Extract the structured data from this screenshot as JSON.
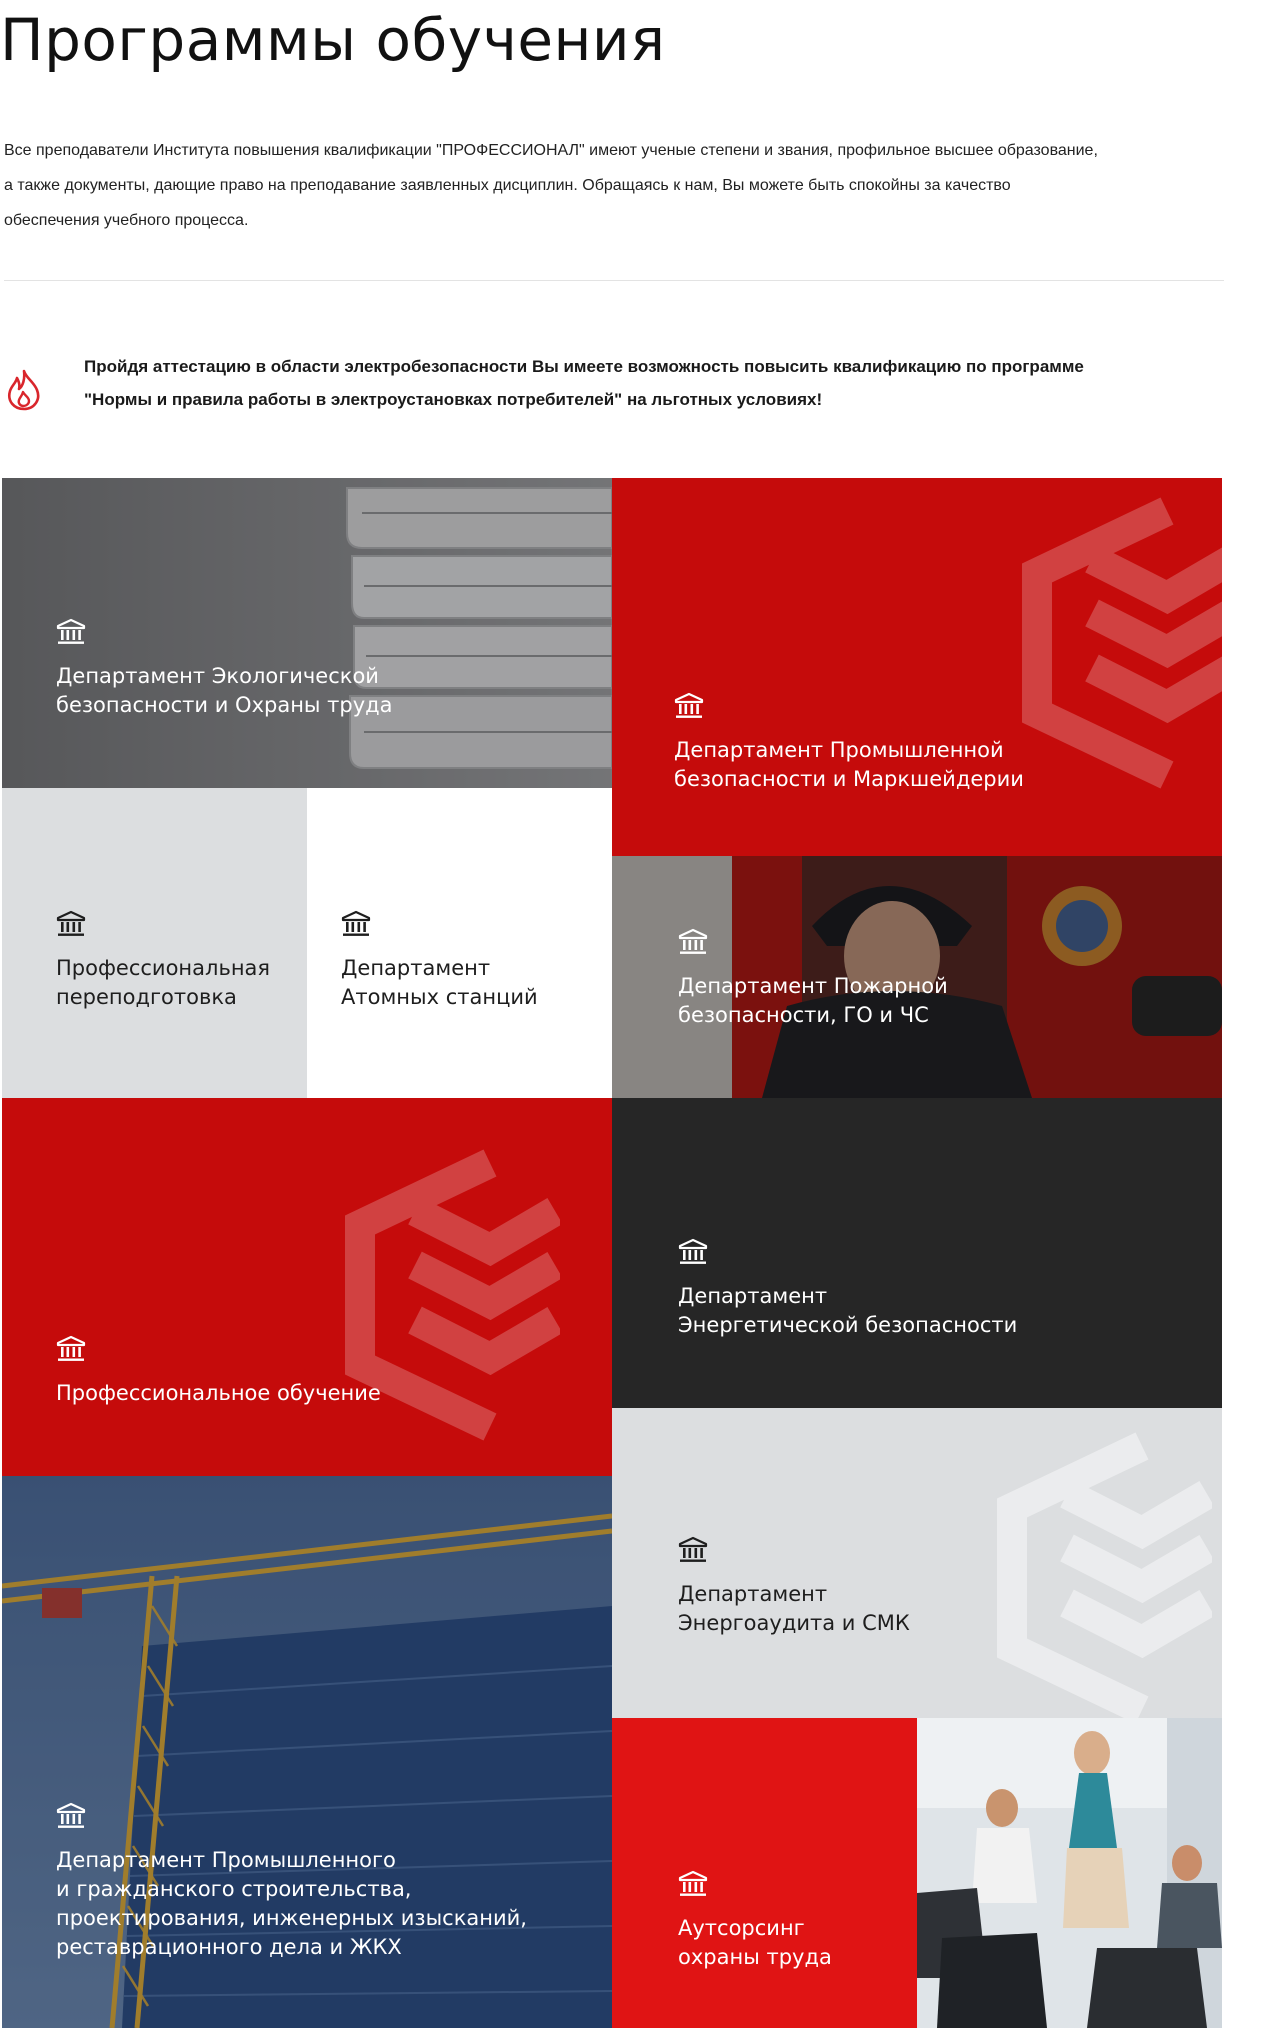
{
  "page": {
    "title": "Программы обучения",
    "intro_lines": [
      "Все преподаватели Института повышения квалификации \"ПРОФЕССИОНАЛ\" имеют ученые степени и звания, профильное высшее образование,",
      "а также документы, дающие право на преподавание заявленных дисциплин. Обращаясь к нам, Вы можете быть спокойны за качество",
      "обеспечения учебного процесса."
    ],
    "notice_lines": [
      "Пройдя аттестацию в области электробезопасности Вы имеете возможность повысить  квалификацию по программе",
      "\"Нормы и  правила работы в электроустановках потребителей\"  на  льготных условиях!"
    ],
    "notice_icon": "fire-icon"
  },
  "tiles": [
    {
      "id": "eco",
      "label": "Департамент Экологической\nбезопасности и Охраны труда",
      "icon": "building-icon"
    },
    {
      "id": "industrial",
      "label": "Департамент Промышленной\nбезопасности и Маркшейдерии",
      "icon": "building-icon"
    },
    {
      "id": "retraining",
      "label": "Профессиональная\nпереподготовка",
      "icon": "building-icon"
    },
    {
      "id": "atomic",
      "label": "Департамент\nАтомных станций",
      "icon": "building-icon"
    },
    {
      "id": "fire",
      "label": "Департамент Пожарной\nбезопасности, ГО и ЧС",
      "icon": "building-icon"
    },
    {
      "id": "training",
      "label": "Профессиональное обучение",
      "icon": "building-icon"
    },
    {
      "id": "energy",
      "label": "Департамент\nЭнергетической безопасности",
      "icon": "building-icon"
    },
    {
      "id": "construction",
      "label": "Департамент Промышленного\nи гражданского строительства,\nпроектирования, инженерных изысканий,\nреставрационного дела и ЖКХ",
      "icon": "building-icon"
    },
    {
      "id": "audit",
      "label": "Департамент\nЭнергоаудита и СМК",
      "icon": "building-icon"
    },
    {
      "id": "outsourcing",
      "label": "Аутсорсинг\nохраны труда",
      "icon": "building-icon"
    }
  ],
  "colors": {
    "red": "#c50b0b",
    "bright_red": "#e01414",
    "dark": "#262626",
    "light_gray": "#dcdee0",
    "white": "#ffffff",
    "accent_icon": "#d9262c"
  }
}
